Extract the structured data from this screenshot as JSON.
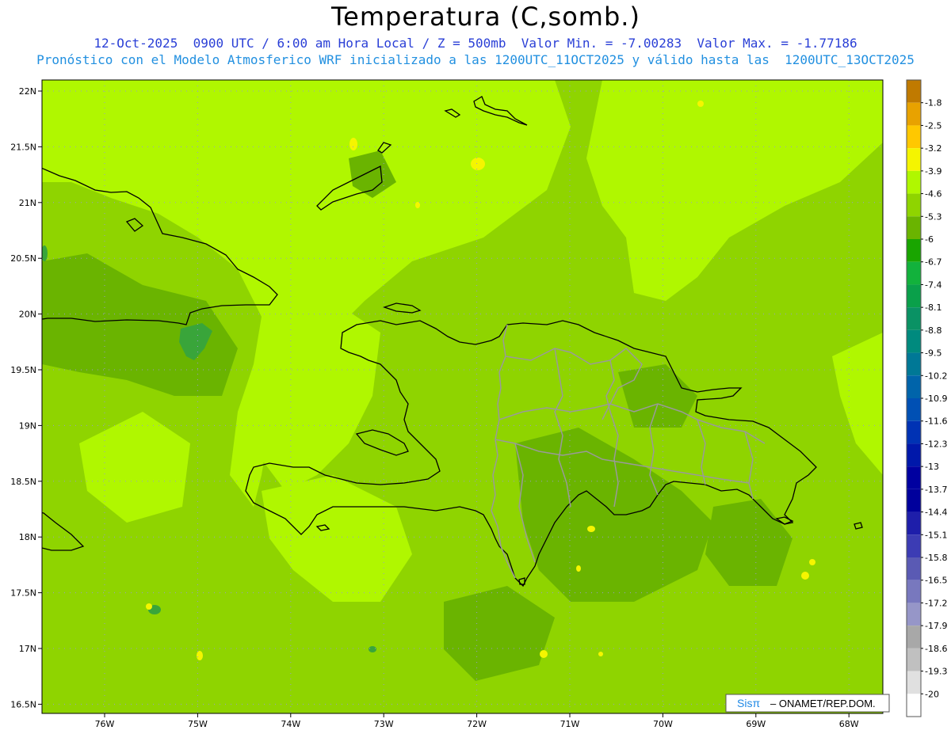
{
  "header": {
    "title": "Temperatura (C,somb.)",
    "subtitle1": "12-Oct-2025  0900 UTC / 6:00 am Hora Local / Z = 500mb  Valor Min. = -7.00283  Valor Max. = -1.77186",
    "subtitle2": "Pronóstico con el Modelo Atmosferico WRF inicializado a las 1200UTC_11OCT2025 y válido hasta las  1200UTC_13OCT2025"
  },
  "map": {
    "lat_labels": [
      "22N",
      "21.5N",
      "21N",
      "20.5N",
      "20N",
      "19.5N",
      "19N",
      "18.5N",
      "18N",
      "17.5N",
      "17N",
      "16.5N"
    ],
    "lon_labels": [
      "76W",
      "75W",
      "74W",
      "73W",
      "72W",
      "71W",
      "70W",
      "69W",
      "68W"
    ],
    "credit_prefix": "Sisπ",
    "credit_text": "– ONAMET/REP.DOM.",
    "colors": {
      "base": "#8fd400",
      "light": "#b0f700",
      "dark": "#6ab400",
      "darker": "#39a53a",
      "coast": "#000000",
      "province": "#9a9a9a",
      "grid": "#9999cc"
    }
  },
  "colorbar": {
    "levels": [
      "-1.8",
      "-2.5",
      "-3.2",
      "-3.9",
      "-4.6",
      "-5.3",
      "-6",
      "-6.7",
      "-7.4",
      "-8.1",
      "-8.8",
      "-9.5",
      "-10.2",
      "-10.9",
      "-11.6",
      "-12.3",
      "-13",
      "-13.7",
      "-14.4",
      "-15.1",
      "-15.8",
      "-16.5",
      "-17.2",
      "-17.9",
      "-18.6",
      "-19.3",
      "-20"
    ],
    "colors": [
      "#c07a00",
      "#e8a200",
      "#ffc800",
      "#f5f500",
      "#b0f700",
      "#8fd400",
      "#6ab400",
      "#19a500",
      "#12b23c",
      "#0aa04a",
      "#0a9264",
      "#008a7e",
      "#007896",
      "#0064aa",
      "#0050b4",
      "#0032b4",
      "#0018aa",
      "#0000a0",
      "#00009c",
      "#1e1eaa",
      "#3c3cb4",
      "#5a5ab4",
      "#7878be",
      "#9696c8",
      "#a8a8a8",
      "#c0c0c0",
      "#e0e0e0",
      "#ffffff"
    ]
  }
}
